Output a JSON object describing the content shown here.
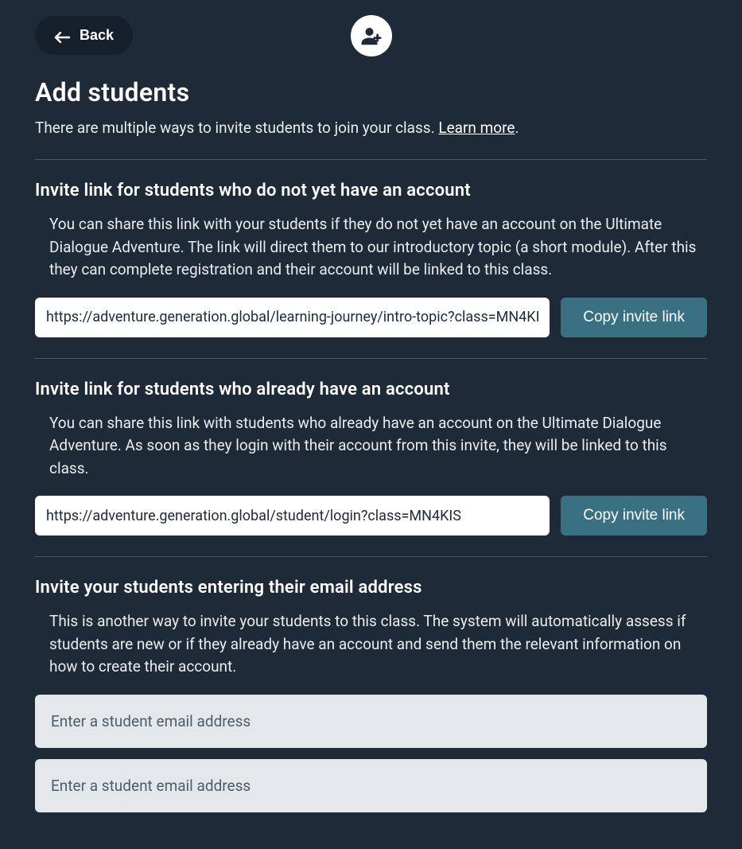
{
  "header": {
    "back_label": "Back"
  },
  "page": {
    "title": "Add students",
    "intro_text": "There are multiple ways to invite students to join your class. ",
    "learn_more": "Learn more",
    "intro_suffix": "."
  },
  "sections": {
    "no_account": {
      "heading": "Invite link for students who do not yet have an account",
      "description": "You can share this link with your students if they do not yet have an account on the Ultimate Dialogue Adventure. The link will direct them to our introductory topic (a short module). After this they can complete registration and their account will be linked to this class.",
      "link_value": "https://adventure.generation.global/learning-journey/intro-topic?class=MN4KI",
      "copy_label": "Copy invite link"
    },
    "has_account": {
      "heading": "Invite link for students who already have an account",
      "description": "You can share this link with students who already have an account on the Ultimate Dialogue Adventure. As soon as they login with their account from this invite, they will be linked to this class.",
      "link_value": "https://adventure.generation.global/student/login?class=MN4KIS",
      "copy_label": "Copy invite link"
    },
    "by_email": {
      "heading": "Invite your students entering their email address",
      "description": "This is another way to invite your students to this class. The system will automatically assess if students are new or if they already have an account and send them the relevant information on how to create their account.",
      "placeholder": "Enter a student email address"
    }
  }
}
